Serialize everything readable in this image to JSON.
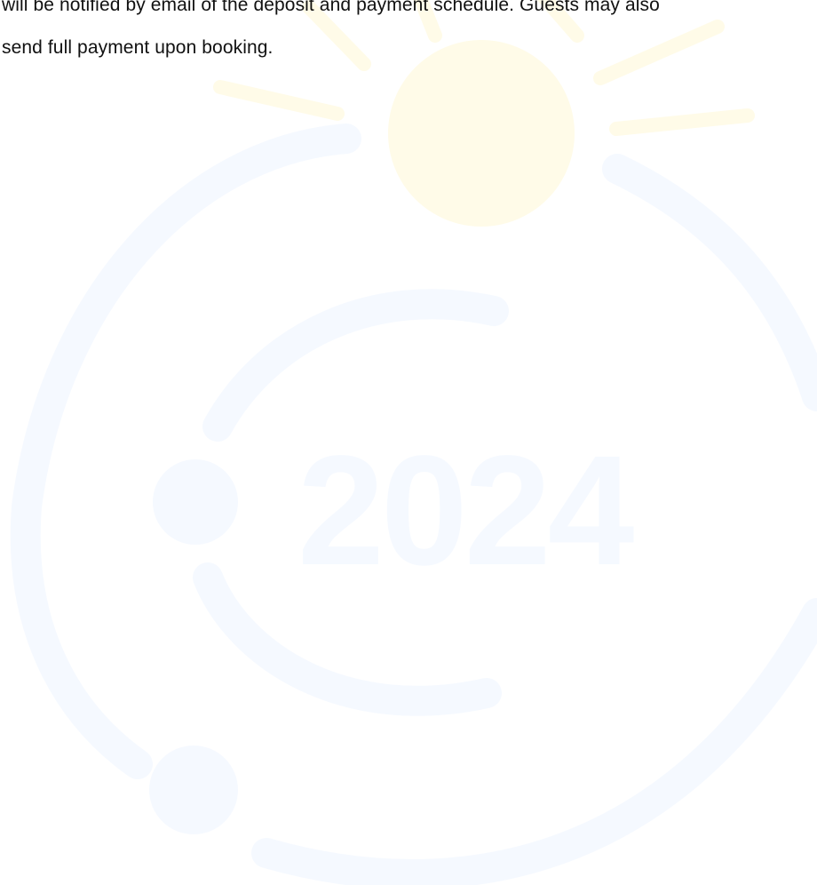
{
  "document": {
    "lines": [
      "will be notified by email of the deposit and payment schedule. Guests may also",
      "send full payment upon booking."
    ]
  },
  "watermark": {
    "year_text": "2024",
    "colors": {
      "sun": "#fffbe8",
      "ray": "#fffbe8",
      "ring": "#f5f9ff",
      "year": "#f5f9ff"
    }
  }
}
